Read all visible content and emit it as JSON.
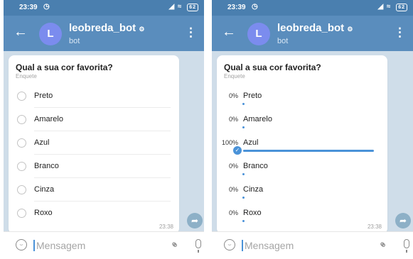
{
  "screens": [
    {
      "status": {
        "time": "23:39",
        "alarm_icon": "alarm-icon",
        "battery": "62"
      },
      "header": {
        "back_icon": "arrow-left-icon",
        "avatar_letter": "L",
        "title": "leobreda_bot",
        "subtitle": "bot",
        "menu_icon": "vertical-dots-icon"
      },
      "poll": {
        "question": "Qual a sua cor favorita?",
        "type_label": "Enquete",
        "options": [
          "Preto",
          "Amarelo",
          "Azul",
          "Branco",
          "Cinza",
          "Roxo"
        ],
        "time": "23:38"
      },
      "composer": {
        "placeholder": "Mensagem"
      }
    },
    {
      "status": {
        "time": "23:39",
        "alarm_icon": "alarm-icon",
        "battery": "62"
      },
      "header": {
        "back_icon": "arrow-left-icon",
        "avatar_letter": "L",
        "title": "leobreda_bot",
        "subtitle": "bot",
        "menu_icon": "vertical-dots-icon"
      },
      "poll": {
        "question": "Qual a sua cor favorita?",
        "type_label": "Enquete",
        "results": [
          {
            "percent": "0%",
            "label": "Preto",
            "fraction": 0,
            "voted": false
          },
          {
            "percent": "0%",
            "label": "Amarelo",
            "fraction": 0,
            "voted": false
          },
          {
            "percent": "100%",
            "label": "Azul",
            "fraction": 1,
            "voted": true
          },
          {
            "percent": "0%",
            "label": "Branco",
            "fraction": 0,
            "voted": false
          },
          {
            "percent": "0%",
            "label": "Cinza",
            "fraction": 0,
            "voted": false
          },
          {
            "percent": "0%",
            "label": "Roxo",
            "fraction": 0,
            "voted": false
          }
        ],
        "time": "23:38"
      },
      "composer": {
        "placeholder": "Mensagem"
      }
    }
  ],
  "colors": {
    "header": "#5a8dbd",
    "statusbar": "#4a7faf",
    "accent": "#4a92d8",
    "chat_background": "#cfdde9",
    "avatar": "#7b8cee"
  }
}
